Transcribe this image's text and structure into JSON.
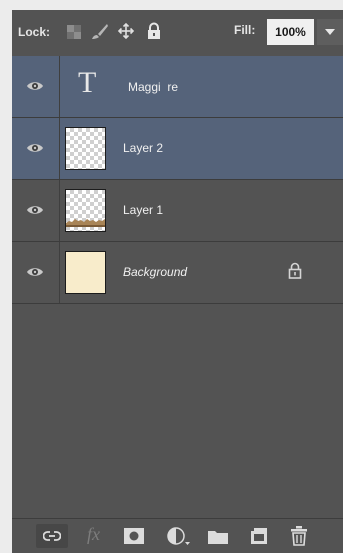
{
  "lock_bar": {
    "lock_label": "Lock:",
    "fill_label": "Fill:",
    "fill_value": "100%",
    "icons": [
      "lock-transparent-pixels-icon",
      "lock-image-pixels-icon",
      "lock-position-icon",
      "lock-all-icon",
      "chevron-down-icon"
    ]
  },
  "layers": [
    {
      "name": "Maggi  re",
      "kind": "type",
      "visible": true,
      "selected": true,
      "thumbnail": "T"
    },
    {
      "name": "Layer 2",
      "kind": "raster",
      "visible": true,
      "selected": true
    },
    {
      "name": "Layer 1",
      "kind": "raster",
      "visible": true,
      "selected": false
    },
    {
      "name": "Background",
      "kind": "background",
      "visible": true,
      "selected": false,
      "locked": true
    }
  ],
  "toolbar": {
    "icons": [
      "link-layers-icon",
      "fx-icon",
      "layer-mask-icon",
      "adjustment-layer-icon",
      "group-folder-icon",
      "new-layer-icon",
      "trash-icon"
    ],
    "fx_label": "fx"
  },
  "colors": {
    "panel": "#535353",
    "selected_row": "#55637a",
    "background_layer_fill": "#f8eccb"
  }
}
